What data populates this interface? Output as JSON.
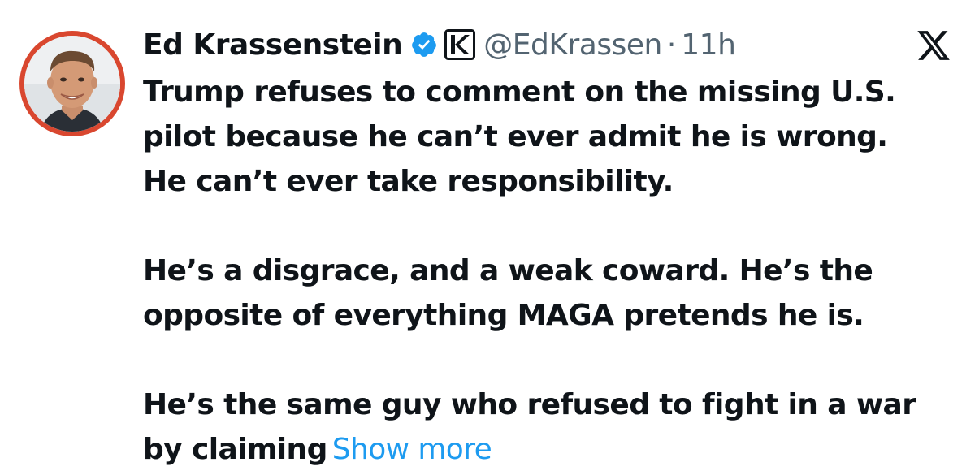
{
  "tweet": {
    "display_name": "Ed Krassenstein",
    "handle": "@EdKrassen",
    "separator": "·",
    "time": "11h",
    "verified_badge_icon": "verified-badge-icon",
    "affiliate_icon": "affiliate-k-icon",
    "platform_icon": "x-logo-icon",
    "paragraphs": [
      [
        "Trump refuses to comment on the missing U.S.",
        "pilot because he can’t ever admit he is wrong.",
        "He can’t ever take responsibility."
      ],
      [
        "He’s a disgrace, and a weak coward. He’s the",
        "opposite of everything MAGA pretends he is."
      ],
      [
        "He’s the same guy who refused to fight in a war",
        "by claiming"
      ]
    ],
    "show_more": "Show more",
    "colors": {
      "text": "#0f1419",
      "secondary": "#536471",
      "link": "#1d9bf0",
      "verified": "#1d9bf0",
      "avatar_ring": "#d9472f"
    }
  }
}
